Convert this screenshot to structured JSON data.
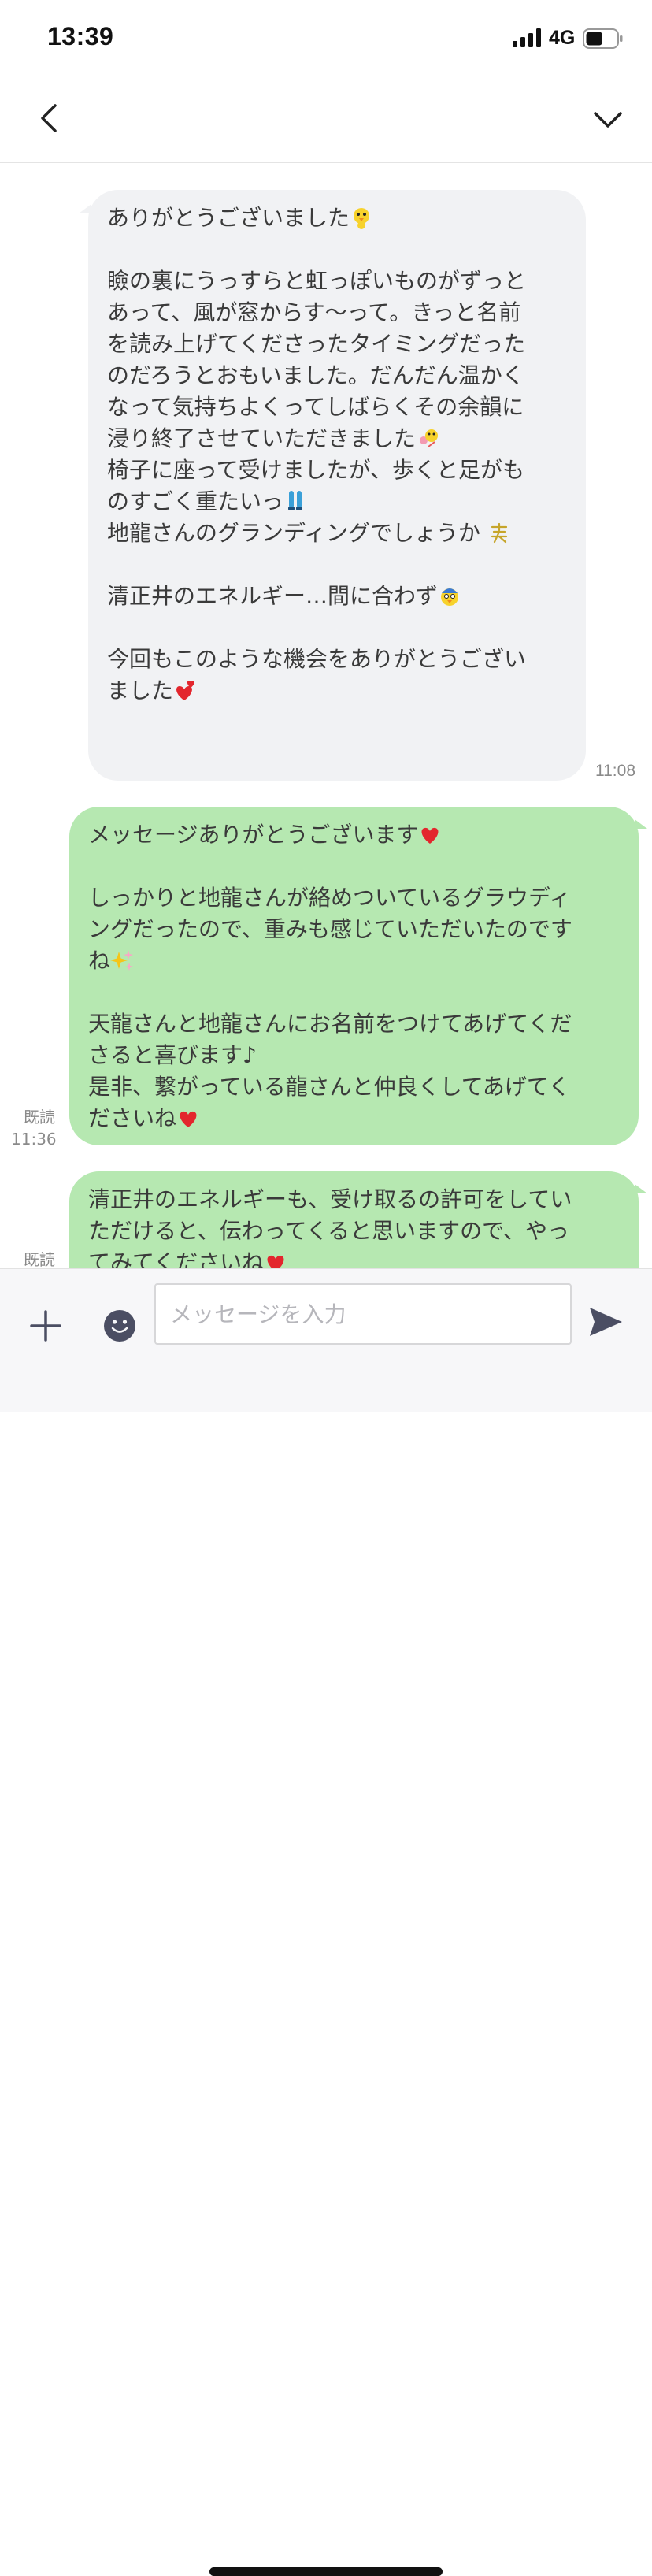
{
  "status_bar": {
    "time": "13:39",
    "network": "4G",
    "battery_level": 0.55
  },
  "header": {
    "title": "",
    "back_icon": "chevron-left-icon",
    "menu_icon": "chevron-down-icon"
  },
  "messages": {
    "incoming_1": {
      "lines": [
        "ありがとうございました",
        "",
        "瞼の裏にうっすらと虹っぽいものがずっと",
        "あって、風が窓からす〜って。きっと名前",
        "を読み上げてくださったタイミングだった",
        "のだろうとおもいました。だんだん温かく",
        "なって気持ちよくってしばらくその余韻に",
        "浸り終了させていただきました",
        "椅子に座って受けましたが、歩くと足がも",
        "のすごく重たいっ",
        "地龍さんのグランディングでしょうか",
        "",
        "清正井のエネルギー…間に合わず",
        "",
        "今回もこのような機会をありがとうござい",
        "ました"
      ],
      "time": "11:08"
    },
    "outgoing_1": {
      "lines": [
        "メッセージありがとうございます",
        "",
        "しっかりと地龍さんが絡めついているグラウディ",
        "ングだったので、重みも感じていただいたのです",
        "ね",
        "",
        "天龍さんと地龍さんにお名前をつけてあげてくだ",
        "さると喜びます♪",
        "是非、繋がっている龍さんと仲良くしてあげてく",
        "ださいね"
      ],
      "read": "既読",
      "time": "11:36"
    },
    "outgoing_2": {
      "lines": [
        "清正井のエネルギーも、受け取るの許可をしてい",
        "ただけると、伝わってくると思いますので、やっ",
        "てみてくださいね"
      ],
      "read": "既読"
    }
  },
  "input_bar": {
    "placeholder": "メッセージを入力",
    "value": "",
    "add_icon": "plus-icon",
    "sticker_icon": "smiley-icon",
    "send_icon": "send-icon"
  },
  "colors": {
    "incoming_bubble": "#f1f2f4",
    "outgoing_bubble": "#b6e8b1",
    "heart": "#e3262d"
  }
}
